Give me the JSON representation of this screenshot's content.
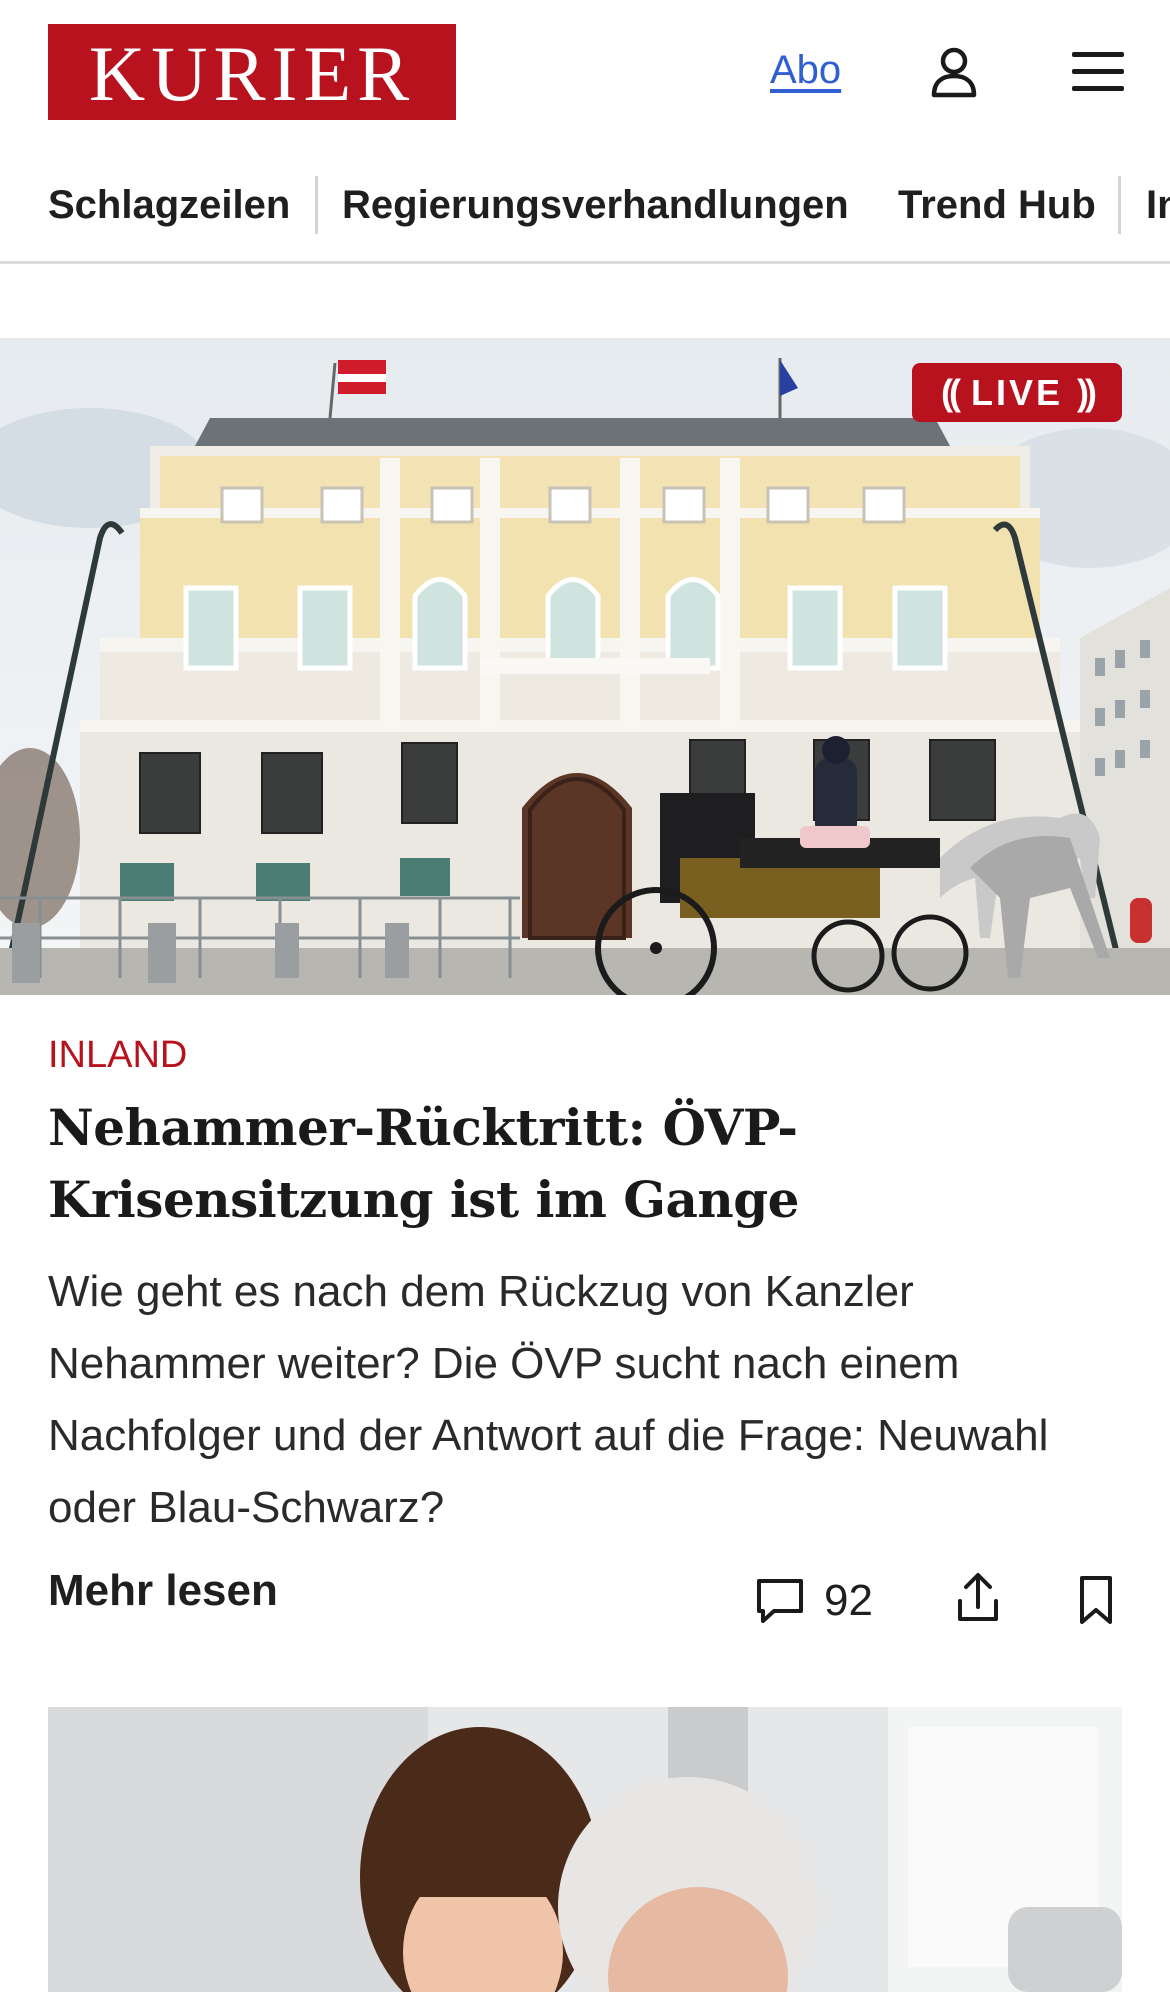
{
  "header": {
    "logo": "KURIER",
    "abo_label": "Abo",
    "user_icon": "user-icon",
    "menu_icon": "hamburger-menu-icon"
  },
  "nav": {
    "items": [
      {
        "label": "Schlagzeilen"
      },
      {
        "label": "Regierungsverhandlungen"
      },
      {
        "label": "Trend Hub"
      },
      {
        "label": "In"
      }
    ]
  },
  "article": {
    "live_badge": "LIVE",
    "kicker": "INLAND",
    "headline": "Nehammer-Rücktritt: ÖVP-Krisensitzung ist im Gange",
    "teaser": "Wie geht es nach dem Rückzug von Kanzler Nehammer weiter? Die ÖVP sucht nach einem Nachfolger und der Antwort auf die Frage: Neuwahl oder Blau-Schwarz?",
    "read_more": "Mehr lesen",
    "comment_count": "92",
    "comment_icon": "comment-icon",
    "share_icon": "share-icon",
    "bookmark_icon": "bookmark-icon"
  },
  "colors": {
    "brand_red": "#b8121f",
    "link_blue": "#2f5fd0",
    "text": "#1a1a1a"
  }
}
